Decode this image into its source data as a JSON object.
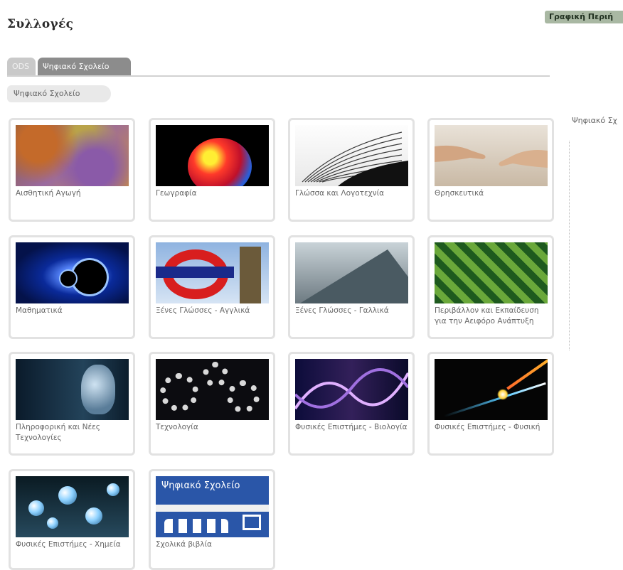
{
  "header": {
    "title": "Συλλογές",
    "badge": "Γραφική Περιή"
  },
  "tabs": [
    {
      "label": "ODS",
      "active": false
    },
    {
      "label": "Ψηφιακό Σχολείο",
      "active": true
    }
  ],
  "breadcrumb": {
    "label": "Ψηφιακό Σχολείο"
  },
  "sidebar": {
    "label": "Ψηφιακό Σχ"
  },
  "collections": [
    {
      "label": "Αισθητική Αγωγή",
      "thumb": "abstract-art-image"
    },
    {
      "label": "Γεωγραφία",
      "thumb": "globe-image"
    },
    {
      "label": "Γλώσσα και Λογοτεχνία",
      "thumb": "open-book-image"
    },
    {
      "label": "Θρησκευτικά",
      "thumb": "creation-hands-image"
    },
    {
      "label": "Μαθηματικά",
      "thumb": "fractal-image"
    },
    {
      "label": "Ξένες Γλώσσες - Αγγλικά",
      "thumb": "london-underground-image"
    },
    {
      "label": "Ξένες Γλώσσες - Γαλλικά",
      "thumb": "louvre-pyramid-image"
    },
    {
      "label": "Περιβάλλον και Εκπαίδευση για την Αειφόρο Ανάπτυξη",
      "thumb": "green-leaves-image"
    },
    {
      "label": "Πληροφορική και Νέες Τεχνολογίες",
      "thumb": "digital-head-image"
    },
    {
      "label": "Τεχνολογία",
      "thumb": "gears-image"
    },
    {
      "label": "Φυσικές Επιστήμες - Βιολογία",
      "thumb": "dna-helix-image"
    },
    {
      "label": "Φυσικές Επιστήμες - Φυσική",
      "thumb": "particle-beam-image"
    },
    {
      "label": "Φυσικές Επιστήμες - Χημεία",
      "thumb": "molecule-image"
    },
    {
      "label": "Σχολικά βιβλία",
      "thumb": "digital-school-banner-image",
      "banner_text": "Ψηφιακό Σχολείο"
    }
  ]
}
